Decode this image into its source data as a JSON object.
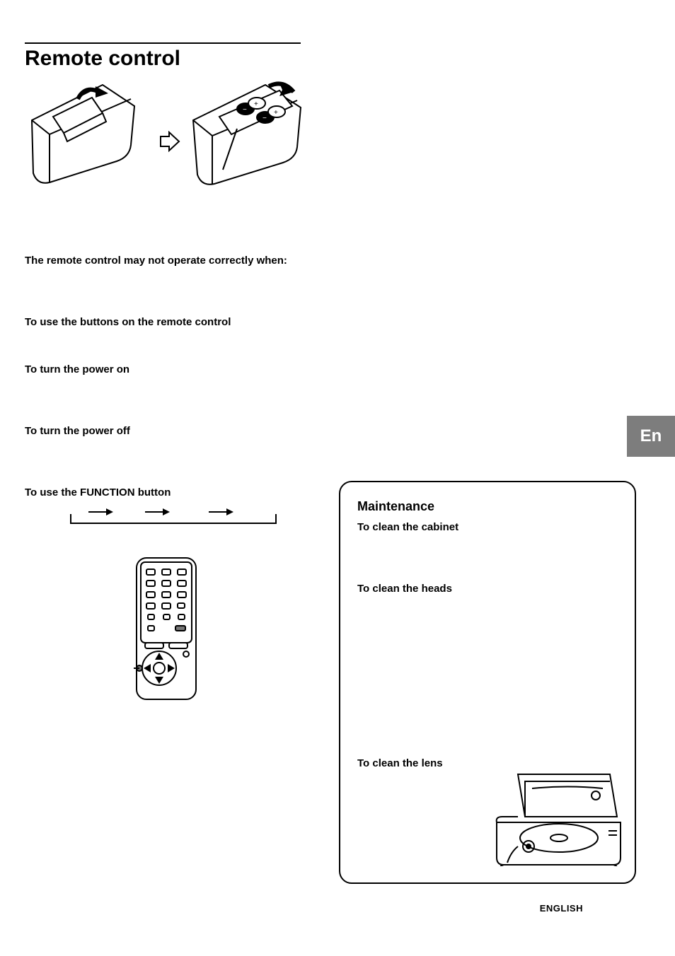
{
  "title": "Remote control",
  "sections": {
    "warn": "The remote control may not operate correctly when:",
    "use_buttons": "To use the buttons on the remote control",
    "power_on": "To turn the power on",
    "power_off": "To turn the power off",
    "function_btn": "To use the FUNCTION button"
  },
  "maintenance": {
    "title": "Maintenance",
    "cabinet": "To clean the cabinet",
    "heads": "To clean the heads",
    "lens": "To clean the lens"
  },
  "side_tab": "En",
  "footer": "ENGLISH"
}
